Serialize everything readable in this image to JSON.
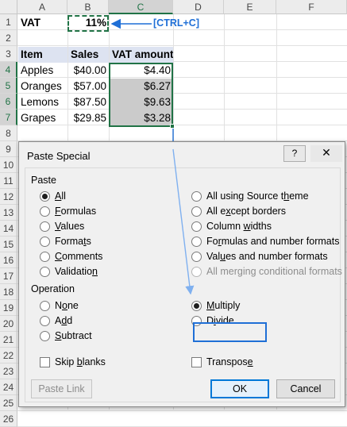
{
  "sheet": {
    "columns": [
      "A",
      "B",
      "C",
      "D",
      "E",
      "F"
    ],
    "rows": [
      "1",
      "2",
      "3",
      "4",
      "5",
      "6",
      "7",
      "8",
      "9",
      "10",
      "11",
      "12",
      "13",
      "14",
      "15",
      "16",
      "17",
      "18",
      "19",
      "20",
      "21",
      "22",
      "23",
      "24",
      "25",
      "26"
    ],
    "cells": {
      "a1": "VAT",
      "b1": "11%",
      "a3": "Item",
      "b3": "Sales",
      "c3": "VAT amount",
      "a4": "Apples",
      "b4": "$40.00",
      "c4": "$4.40",
      "a5": "Oranges",
      "b5": "$57.00",
      "c5": "$6.27",
      "a6": "Lemons",
      "b6": "$87.50",
      "c6": "$9.63",
      "a7": "Grapes",
      "b7": "$29.85",
      "c7": "$3.28"
    },
    "annotation": "[CTRL+C]"
  },
  "dialog": {
    "title": "Paste Special",
    "help": "?",
    "close": "✕",
    "paste_label": "Paste",
    "paste_options_left": [
      {
        "pre": "",
        "key": "A",
        "post": "ll",
        "selected": true
      },
      {
        "pre": "",
        "key": "F",
        "post": "ormulas",
        "selected": false
      },
      {
        "pre": "",
        "key": "V",
        "post": "alues",
        "selected": false
      },
      {
        "pre": "Forma",
        "key": "t",
        "post": "s",
        "selected": false
      },
      {
        "pre": "",
        "key": "C",
        "post": "omments",
        "selected": false
      },
      {
        "pre": "Validatio",
        "key": "n",
        "post": "",
        "selected": false
      }
    ],
    "paste_options_right": [
      {
        "pre": "All using Source t",
        "key": "h",
        "post": "eme",
        "selected": false,
        "disabled": false
      },
      {
        "pre": "All e",
        "key": "x",
        "post": "cept borders",
        "selected": false,
        "disabled": false
      },
      {
        "pre": "Column ",
        "key": "w",
        "post": "idths",
        "selected": false,
        "disabled": false
      },
      {
        "pre": "Fo",
        "key": "r",
        "post": "mulas and number formats",
        "selected": false,
        "disabled": false
      },
      {
        "pre": "Val",
        "key": "u",
        "post": "es and number formats",
        "selected": false,
        "disabled": false
      },
      {
        "pre": "All mer",
        "key": "g",
        "post": "ing conditional formats",
        "selected": false,
        "disabled": true
      }
    ],
    "operation_label": "Operation",
    "operation_left": [
      {
        "pre": "N",
        "key": "o",
        "post": "ne",
        "selected": false
      },
      {
        "pre": "A",
        "key": "d",
        "post": "d",
        "selected": false
      },
      {
        "pre": "",
        "key": "S",
        "post": "ubtract",
        "selected": false
      }
    ],
    "operation_right": [
      {
        "pre": "",
        "key": "M",
        "post": "ultiply",
        "selected": true
      },
      {
        "pre": "D",
        "key": "i",
        "post": "vide",
        "selected": false
      }
    ],
    "skip_blanks": {
      "pre": "Skip ",
      "key": "b",
      "post": "lanks",
      "checked": false
    },
    "transpose": {
      "pre": "Transpos",
      "key": "e",
      "post": "",
      "checked": false
    },
    "paste_link": "Paste Link",
    "ok": "OK",
    "cancel": "Cancel"
  },
  "colors": {
    "excel_green": "#217346",
    "annotation_blue": "#1f6fd6",
    "header_fill": "#dde3f1",
    "selection_fill": "#cbcbcb"
  }
}
